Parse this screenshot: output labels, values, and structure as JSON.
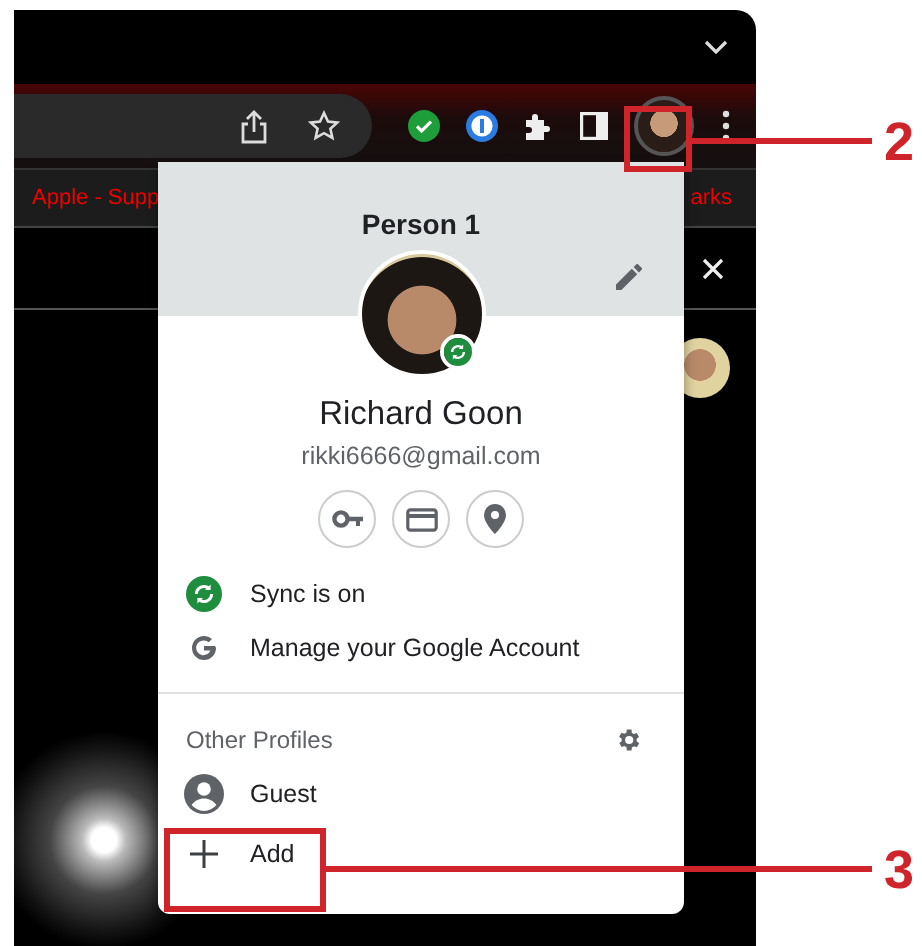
{
  "browser": {
    "bookmarks": [
      "Apple - Supp",
      "arks"
    ]
  },
  "profile_menu": {
    "title": "Person 1",
    "name": "Richard Goon",
    "email": "rikki6666@gmail.com",
    "sync_label": "Sync is on",
    "manage_account": "Manage your Google Account",
    "other_profiles_heading": "Other Profiles",
    "profiles": [
      {
        "label": "Guest",
        "kind": "guest"
      },
      {
        "label": "Add",
        "kind": "add"
      }
    ]
  },
  "callouts": [
    {
      "number": "2"
    },
    {
      "number": "3"
    }
  ]
}
